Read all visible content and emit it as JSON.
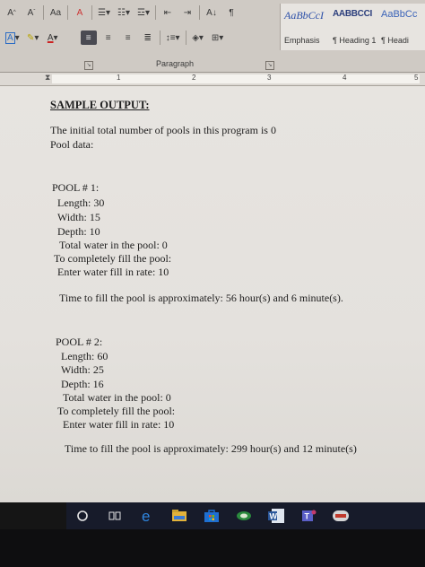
{
  "ribbon": {
    "font_size_grow": "A",
    "font_size_shrink": "A",
    "change_case": "Aa",
    "clear_format": "A",
    "text_color_letter": "A",
    "sort": "A↓",
    "pilcrow": "¶",
    "paragraph_group_label": "Paragraph",
    "styles": [
      {
        "preview": "AaBbCcI",
        "name": "Emphasis"
      },
      {
        "preview": "AABBCCI",
        "name": "¶ Heading 1"
      },
      {
        "preview": "AaBbCc",
        "name": "¶ Headi"
      }
    ]
  },
  "ruler": {
    "numbers": [
      "1",
      "2",
      "3",
      "4",
      "5"
    ]
  },
  "document": {
    "heading": "SAMPLE OUTPUT:",
    "intro_line": "The initial total number of pools in this program is 0",
    "pool_data": "Pool data:",
    "pool1": {
      "title": "POOL # 1:",
      "length": "Length: 30",
      "width": "Width: 15",
      "depth": "Depth: 10",
      "total_water": "Total water in the pool: 0",
      "to_fill": "To completely fill the pool:",
      "fill_rate": "Enter water fill in rate: 10",
      "time": "Time to fill the pool is approximately: 56 hour(s) and 6 minute(s)."
    },
    "pool2": {
      "title": "POOL # 2:",
      "length": "Length: 60",
      "width": "Width: 25",
      "depth": "Depth: 16",
      "total_water": "Total water in the pool: 0",
      "to_fill": "To completely fill the pool:",
      "fill_rate": "Enter water fill in rate: 10",
      "time": "Time to fill the pool is approximately: 299 hour(s) and 12 minute(s)"
    }
  },
  "taskbar": {
    "icons": [
      "cortana-icon",
      "task-view-icon",
      "edge-icon",
      "file-explorer-icon",
      "store-icon",
      "photos-icon",
      "word-icon",
      "teams-icon",
      "app-icon"
    ]
  },
  "colors": {
    "ribbon_bg": "#cfcac4",
    "page_bg": "#e6e3df",
    "taskbar_bg": "#171b2a",
    "style_blue": "#2b4fa8"
  }
}
